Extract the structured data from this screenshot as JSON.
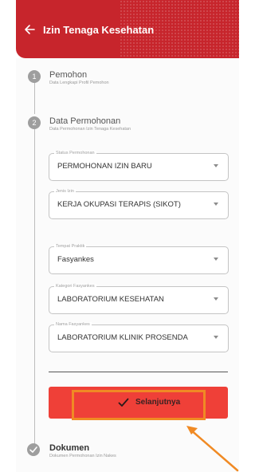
{
  "header": {
    "title": "Izin Tenaga Kesehatan",
    "back_icon": "arrow-left-icon"
  },
  "steps": [
    {
      "number": "1",
      "title": "Pemohon",
      "subtitle": "Data Lengkapi Profil Pemohon"
    },
    {
      "number": "2",
      "title": "Data Permohonan",
      "subtitle": "Data Permohonan Izin Tenaga Kesehatan"
    },
    {
      "title": "Dokumen",
      "subtitle": "Dokumen Permohonan Izin Nakes",
      "icon": "check-icon"
    }
  ],
  "form": {
    "status": {
      "label": "Status Permohonan",
      "value": "PERMOHONAN IZIN BARU"
    },
    "jenis_izin": {
      "label": "Jenis Izin",
      "value": "KERJA OKUPASI TERAPIS (SIKOT)"
    },
    "tempat_praktik": {
      "label": "Tempat Praktik",
      "value": "Fasyankes"
    },
    "kategori": {
      "label": "Kategori Fasyankes",
      "value": "LABORATORIUM KESEHATAN"
    },
    "nama": {
      "label": "Nama Fasyankes",
      "value": "LABORATORIUM KLINIK PROSENDA"
    }
  },
  "next_button": {
    "label": "Selanjutnya"
  },
  "colors": {
    "brand_red": "#c7252c",
    "button_red": "#ef4038",
    "highlight_orange": "#f08a24"
  }
}
